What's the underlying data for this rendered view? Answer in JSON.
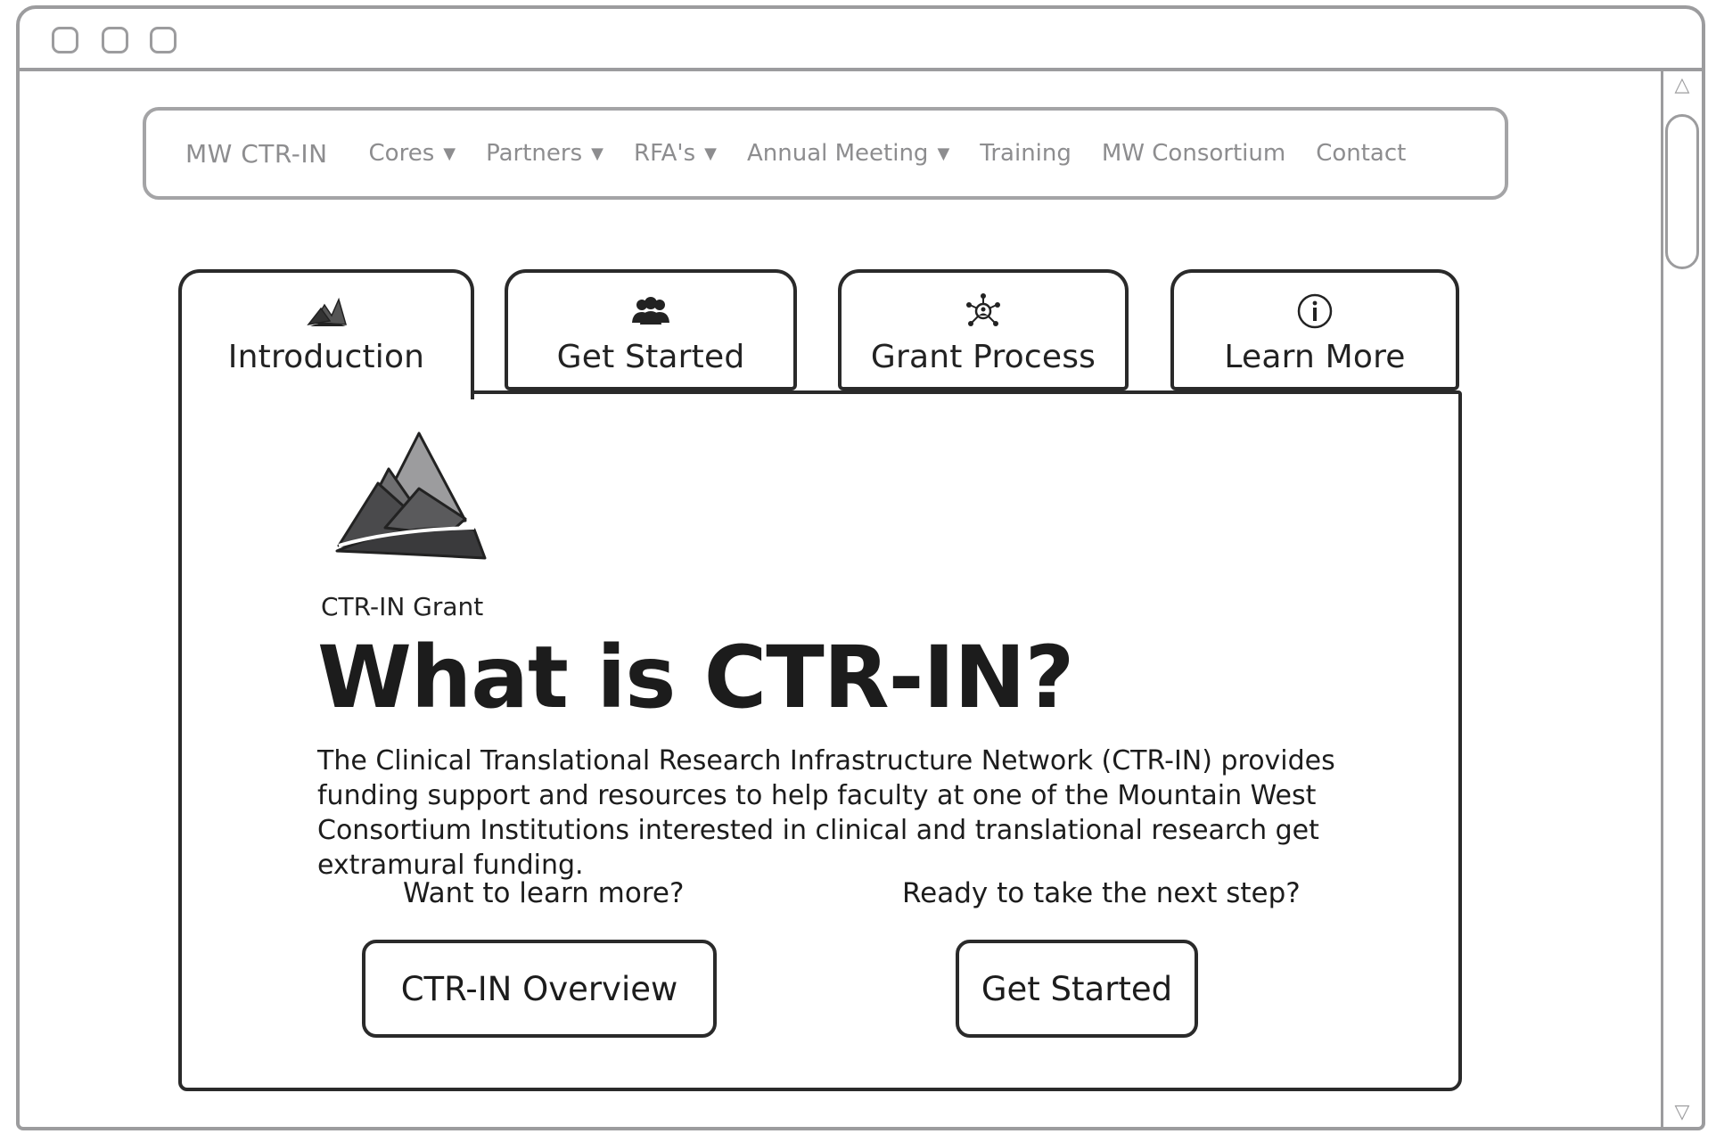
{
  "nav": {
    "brand": "MW CTR-IN",
    "items": [
      {
        "label": "Cores",
        "dropdown": true
      },
      {
        "label": "Partners",
        "dropdown": true
      },
      {
        "label": "RFA's",
        "dropdown": true
      },
      {
        "label": "Annual Meeting",
        "dropdown": true
      },
      {
        "label": "Training",
        "dropdown": false
      },
      {
        "label": "MW Consortium",
        "dropdown": false
      },
      {
        "label": "Contact",
        "dropdown": false
      }
    ]
  },
  "tabs": [
    {
      "label": "Introduction",
      "icon": "mountain-icon",
      "active": true
    },
    {
      "label": "Get Started",
      "icon": "group-icon",
      "active": false
    },
    {
      "label": "Grant Process",
      "icon": "network-icon",
      "active": false
    },
    {
      "label": "Learn More",
      "icon": "info-icon",
      "active": false
    }
  ],
  "content": {
    "eyebrow": "CTR-IN Grant",
    "headline": "What is CTR-IN?",
    "description": "The Clinical Translational Research Infrastructure Network (CTR-IN) provides funding support and resources to help faculty at one of the Mountain West Consortium Institutions interested in clinical and translational research get extramural funding.",
    "learn_prompt": "Want to learn more?",
    "learn_button": "CTR-IN Overview",
    "next_prompt": "Ready to take the next step?",
    "next_button": "Get Started"
  },
  "colors": {
    "ink": "#1c1c1c",
    "frame_gray": "#9c9c9e",
    "nav_text": "#8d8d8f"
  }
}
